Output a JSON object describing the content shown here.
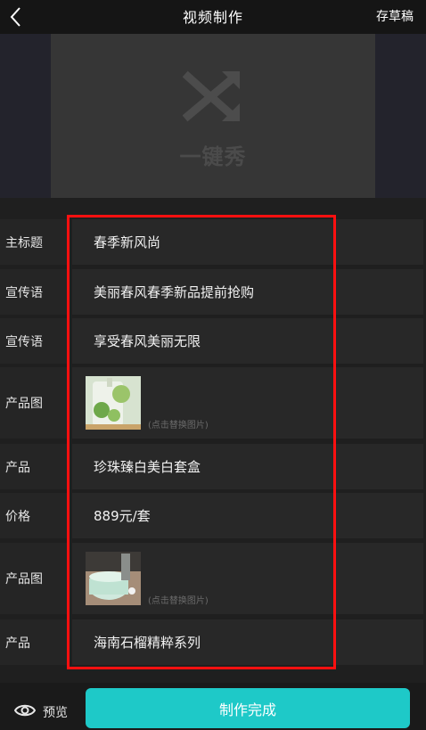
{
  "header": {
    "back_icon": "chevron-left-icon",
    "title": "视频制作",
    "draft_label": "存草稿"
  },
  "banner": {
    "logo_icon": "shuffle-icon",
    "logo_text": "一键秀"
  },
  "form": {
    "rows": [
      {
        "label": "主标题",
        "value": "春季新风尚"
      },
      {
        "label": "宣传语",
        "value": "美丽春风春季新品提前抢购"
      },
      {
        "label": "宣传语",
        "value": "享受春风美丽无限"
      },
      {
        "label": "产品图",
        "hint": "(点击替换图片)"
      },
      {
        "label": "产品",
        "value": "珍珠臻白美白套盒"
      },
      {
        "label": "价格",
        "value": "889元/套"
      },
      {
        "label": "产品图",
        "hint": "(点击替换图片)"
      },
      {
        "label": "产品",
        "value": "海南石榴精粹系列"
      }
    ]
  },
  "footer": {
    "preview_icon": "eye-icon",
    "preview_label": "预览",
    "done_label": "制作完成"
  }
}
